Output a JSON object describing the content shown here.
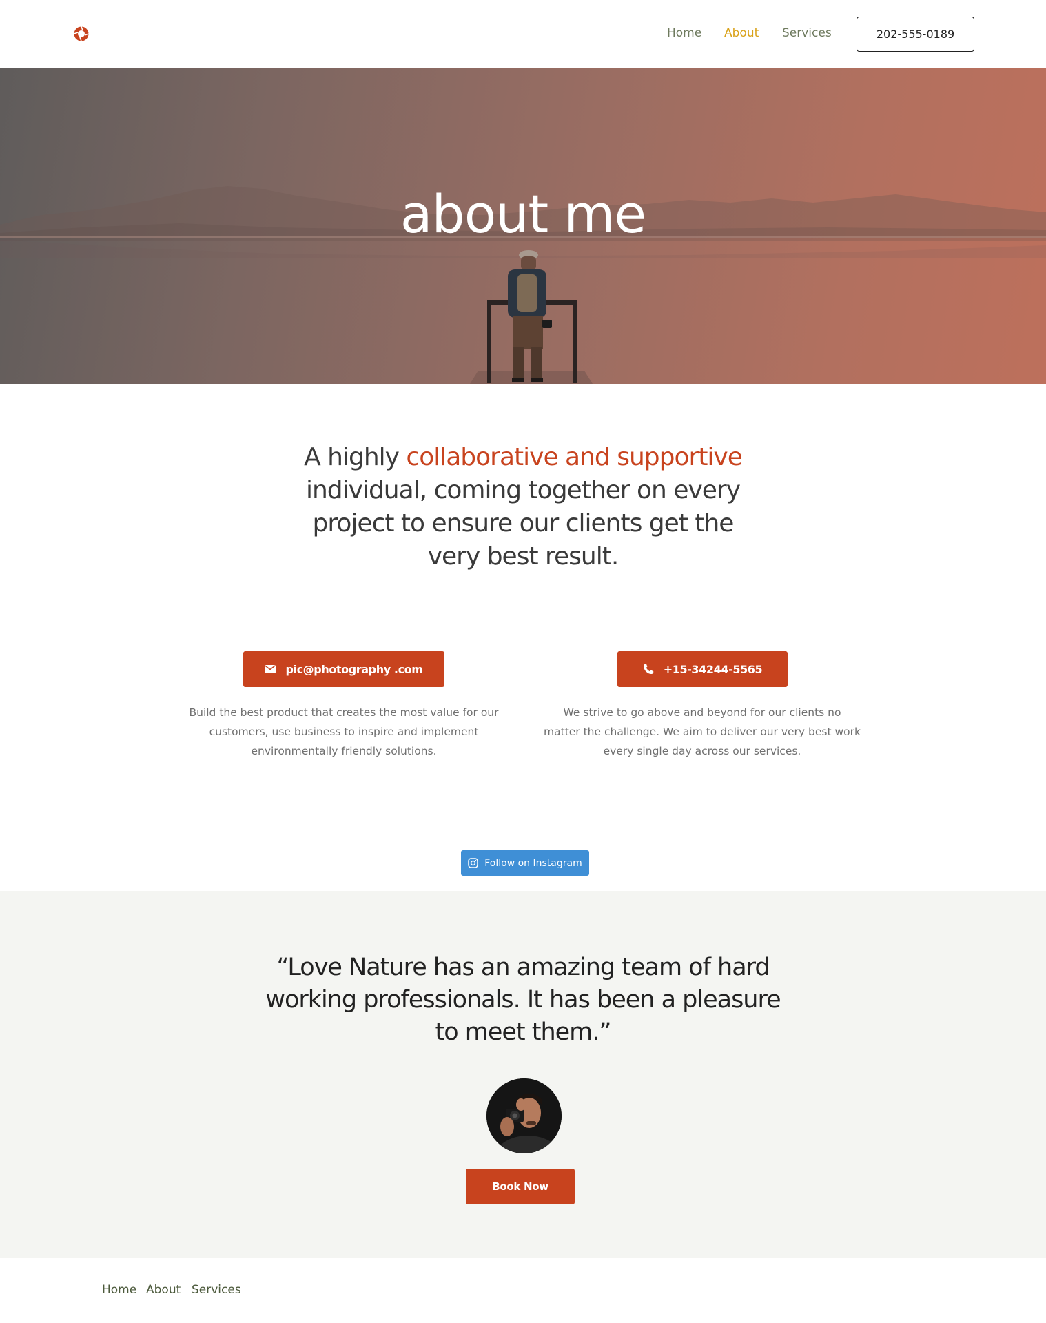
{
  "header": {
    "logo_icon": "aperture-icon",
    "nav": [
      "Home",
      "About",
      "Services"
    ],
    "active_nav": "About",
    "phone_button": "202-555-0189"
  },
  "hero": {
    "title": "about me"
  },
  "intro": {
    "prefix": "A highly ",
    "highlight": "collaborative and supportive",
    "rest_line1": "individual, coming together on every",
    "rest_line2": "project to ensure our clients get the",
    "rest_line3": "very best result."
  },
  "contacts": [
    {
      "icon": "envelope-icon",
      "label": "pic@photography .com",
      "description": "Build the best product that creates the most value for our customers, use business to inspire and implement environmentally friendly solutions."
    },
    {
      "icon": "phone-icon",
      "label": "+15-34244-5565",
      "description": "We strive to go above and beyond for our clients no matter the challenge. We aim to deliver our very best work every single day across our services."
    }
  ],
  "instagram": {
    "icon": "instagram-icon",
    "label": "Follow on Instagram"
  },
  "testimonial": {
    "quote": "“Love Nature has an amazing team of hard working professionals. It has been a pleasure to meet them.”",
    "button": "Book Now"
  },
  "footer": {
    "nav": [
      "Home",
      "About",
      "Services"
    ]
  },
  "colors": {
    "accent": "#c8431e",
    "nav_active": "#d9a21a",
    "nav_text": "#6e7a5e",
    "instagram": "#3f8fd6",
    "testimonial_bg": "#f4f5f2"
  }
}
